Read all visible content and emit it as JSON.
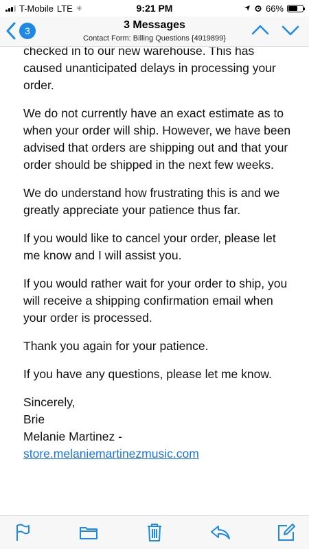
{
  "status_bar": {
    "carrier": "T-Mobile",
    "network": "LTE",
    "time": "9:21 PM",
    "battery_percent": "66%",
    "battery_level": 0.66
  },
  "nav": {
    "back_count": "3",
    "title": "3 Messages",
    "subtitle": "Contact Form: Billing Questions {4919899}"
  },
  "email": {
    "paragraphs": [
      "checked in to our new warehouse. This has caused unanticipated delays in processing your order.",
      "We do not currently have an exact estimate as to when your order will ship. However, we have been advised that orders are shipping out and that your order should be shipped in the next few weeks.",
      "We do understand how frustrating this is and we greatly appreciate your patience thus far.",
      "If you would like to cancel your order, please let me know and I will assist you.",
      "If you would rather wait for your order to ship, you will receive a shipping confirmation email when your order is processed.",
      "Thank you again for your patience.",
      "If you have any questions, please let me know."
    ],
    "signature": {
      "closing": "Sincerely,",
      "name": "Brie",
      "org": "Melanie Martinez -",
      "link": "store.melaniemartinezmusic.com"
    }
  },
  "colors": {
    "accent": "#1e88e5",
    "link": "#1a73e8"
  },
  "toolbar_icons": [
    "flag-icon",
    "folder-icon",
    "trash-icon",
    "reply-icon",
    "compose-icon"
  ]
}
